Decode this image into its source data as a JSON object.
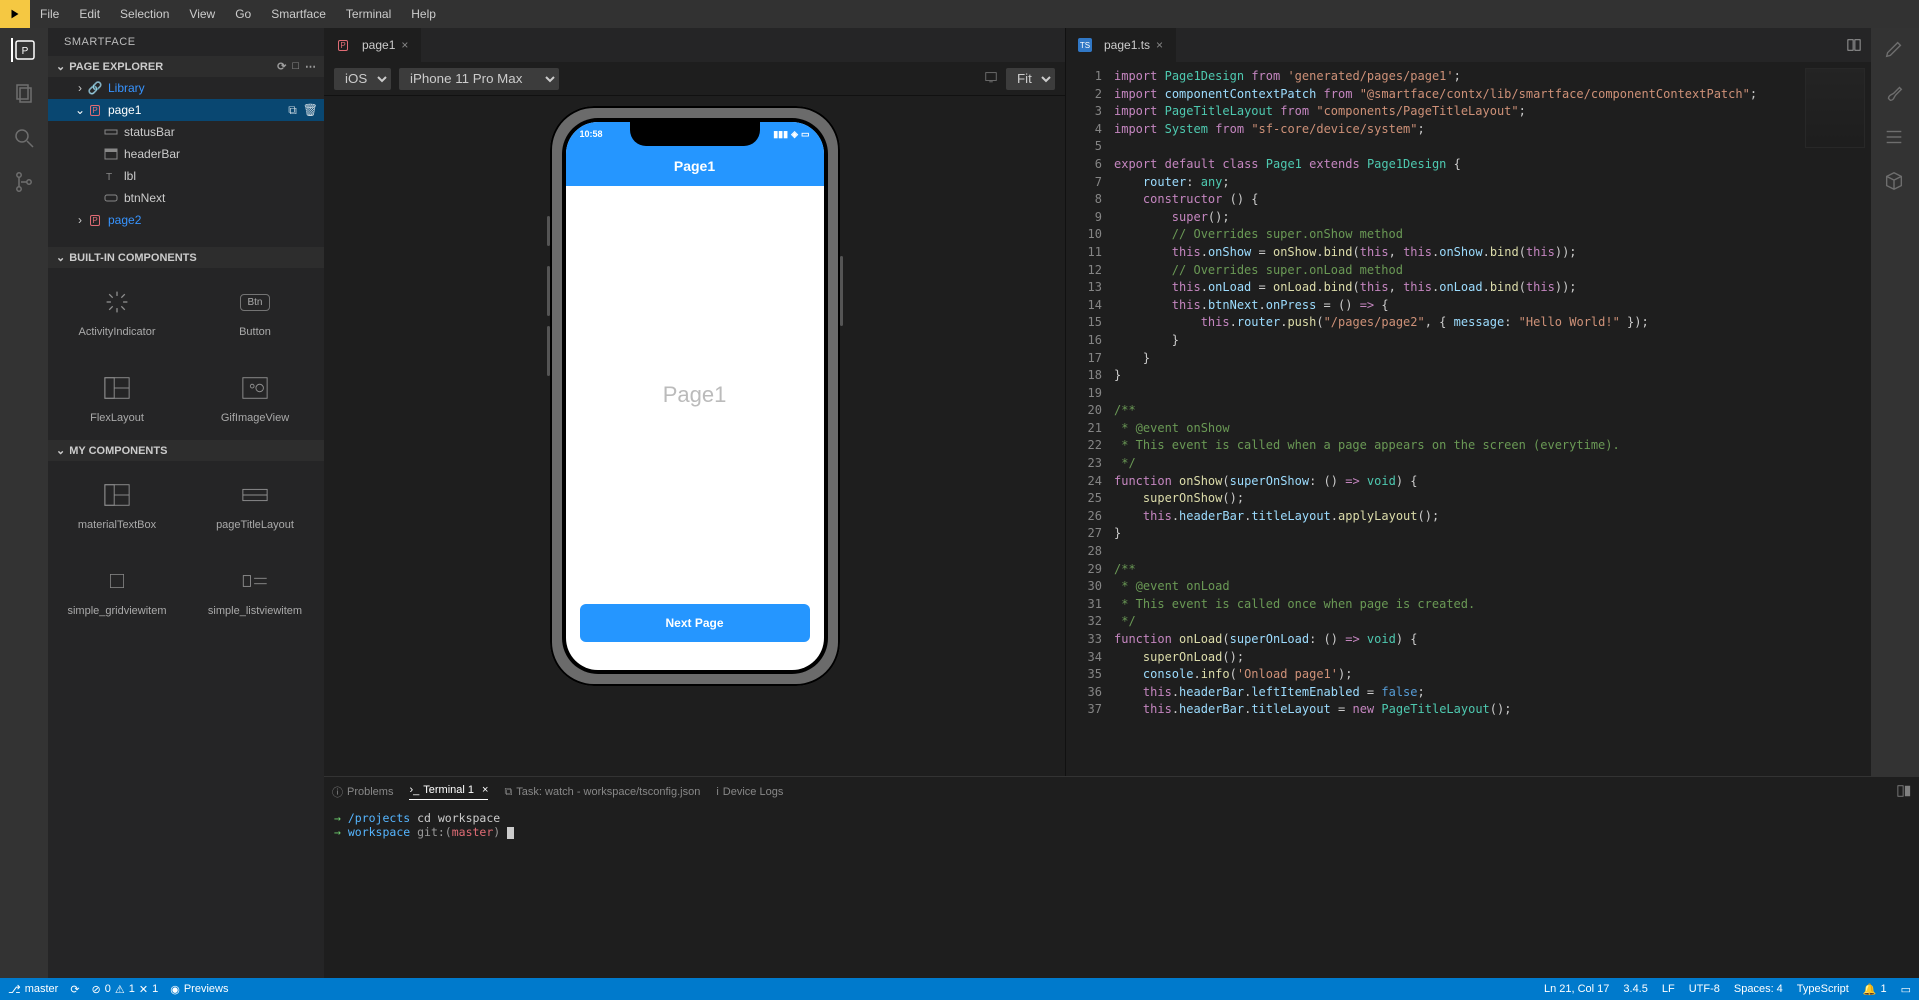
{
  "menubar": [
    "File",
    "Edit",
    "Selection",
    "View",
    "Go",
    "Smartface",
    "Terminal",
    "Help"
  ],
  "sidebar": {
    "title": "SMARTFACE",
    "sections": {
      "explorer": "PAGE EXPLORER",
      "builtin": "BUILT-IN COMPONENTS",
      "mycomp": "MY COMPONENTS"
    },
    "tree": {
      "library": "Library",
      "page1": "page1",
      "page1_children": [
        "statusBar",
        "headerBar",
        "lbl",
        "btnNext"
      ],
      "page2": "page2"
    },
    "builtin_items": [
      "ActivityIndicator",
      "Button",
      "FlexLayout",
      "GifImageView"
    ],
    "mycomp_items": [
      "materialTextBox",
      "pageTitleLayout",
      "simple_gridviewitem",
      "simple_listviewitem"
    ]
  },
  "designer": {
    "tab": "page1",
    "os": "iOS",
    "device": "iPhone 11 Pro Max",
    "zoom": "Fit",
    "phone": {
      "time": "10:58",
      "header_title": "Page1",
      "body_label": "Page1",
      "button": "Next Page"
    }
  },
  "editor": {
    "tab": "page1.ts",
    "lines": [
      {
        "n": 1,
        "html": "<span class='tok-kw'>import</span> <span class='tok-type'>Page1Design</span> <span class='tok-kw'>from</span> <span class='tok-str'>'generated/pages/page1'</span>;"
      },
      {
        "n": 2,
        "html": "<span class='tok-kw'>import</span> <span class='tok-var'>componentContextPatch</span> <span class='tok-kw'>from</span> <span class='tok-str'>\"@smartface/contx/lib/smartface/componentContextPatch\"</span>;"
      },
      {
        "n": 3,
        "html": "<span class='tok-kw'>import</span> <span class='tok-type'>PageTitleLayout</span> <span class='tok-kw'>from</span> <span class='tok-str'>\"components/PageTitleLayout\"</span>;"
      },
      {
        "n": 4,
        "html": "<span class='tok-kw'>import</span> <span class='tok-type'>System</span> <span class='tok-kw'>from</span> <span class='tok-str'>\"sf-core/device/system\"</span>;"
      },
      {
        "n": 5,
        "html": ""
      },
      {
        "n": 6,
        "html": "<span class='tok-kw'>export</span> <span class='tok-kw'>default</span> <span class='tok-kw'>class</span> <span class='tok-type'>Page1</span> <span class='tok-kw'>extends</span> <span class='tok-type'>Page1Design</span> {"
      },
      {
        "n": 7,
        "html": "    <span class='tok-var'>router</span>: <span class='tok-type'>any</span>;"
      },
      {
        "n": 8,
        "html": "    <span class='tok-kw'>constructor</span> () {"
      },
      {
        "n": 9,
        "html": "        <span class='tok-kw'>super</span>();"
      },
      {
        "n": 10,
        "html": "        <span class='tok-comm'>// Overrides super.onShow method</span>"
      },
      {
        "n": 11,
        "html": "        <span class='tok-kw'>this</span>.<span class='tok-var'>onShow</span> = <span class='tok-fn'>onShow</span>.<span class='tok-fn'>bind</span>(<span class='tok-kw'>this</span>, <span class='tok-kw'>this</span>.<span class='tok-var'>onShow</span>.<span class='tok-fn'>bind</span>(<span class='tok-kw'>this</span>));"
      },
      {
        "n": 12,
        "html": "        <span class='tok-comm'>// Overrides super.onLoad method</span>"
      },
      {
        "n": 13,
        "html": "        <span class='tok-kw'>this</span>.<span class='tok-var'>onLoad</span> = <span class='tok-fn'>onLoad</span>.<span class='tok-fn'>bind</span>(<span class='tok-kw'>this</span>, <span class='tok-kw'>this</span>.<span class='tok-var'>onLoad</span>.<span class='tok-fn'>bind</span>(<span class='tok-kw'>this</span>));"
      },
      {
        "n": 14,
        "html": "        <span class='tok-kw'>this</span>.<span class='tok-var'>btnNext</span>.<span class='tok-var'>onPress</span> = () <span class='tok-kw'>=&gt;</span> {"
      },
      {
        "n": 15,
        "html": "            <span class='tok-kw'>this</span>.<span class='tok-var'>router</span>.<span class='tok-fn'>push</span>(<span class='tok-str'>\"/pages/page2\"</span>, { <span class='tok-var'>message</span>: <span class='tok-str'>\"Hello World!\"</span> });"
      },
      {
        "n": 16,
        "html": "        }"
      },
      {
        "n": 17,
        "html": "    }"
      },
      {
        "n": 18,
        "html": "}"
      },
      {
        "n": 19,
        "html": ""
      },
      {
        "n": 20,
        "html": "<span class='tok-comm'>/**</span>"
      },
      {
        "n": 21,
        "html": "<span class='tok-comm'> * @event onShow</span>"
      },
      {
        "n": 22,
        "html": "<span class='tok-comm'> * This event is called when a page appears on the screen (everytime).</span>"
      },
      {
        "n": 23,
        "html": "<span class='tok-comm'> */</span>"
      },
      {
        "n": 24,
        "html": "<span class='tok-kw'>function</span> <span class='tok-fn'>onShow</span>(<span class='tok-var'>superOnShow</span>: () <span class='tok-kw'>=&gt;</span> <span class='tok-type'>void</span>) {"
      },
      {
        "n": 25,
        "html": "    <span class='tok-fn'>superOnShow</span>();"
      },
      {
        "n": 26,
        "html": "    <span class='tok-kw'>this</span>.<span class='tok-var'>headerBar</span>.<span class='tok-var'>titleLayout</span>.<span class='tok-fn'>applyLayout</span>();"
      },
      {
        "n": 27,
        "html": "}"
      },
      {
        "n": 28,
        "html": ""
      },
      {
        "n": 29,
        "html": "<span class='tok-comm'>/**</span>"
      },
      {
        "n": 30,
        "html": "<span class='tok-comm'> * @event onLoad</span>"
      },
      {
        "n": 31,
        "html": "<span class='tok-comm'> * This event is called once when page is created.</span>"
      },
      {
        "n": 32,
        "html": "<span class='tok-comm'> */</span>"
      },
      {
        "n": 33,
        "html": "<span class='tok-kw'>function</span> <span class='tok-fn'>onLoad</span>(<span class='tok-var'>superOnLoad</span>: () <span class='tok-kw'>=&gt;</span> <span class='tok-type'>void</span>) {"
      },
      {
        "n": 34,
        "html": "    <span class='tok-fn'>superOnLoad</span>();"
      },
      {
        "n": 35,
        "html": "    <span class='tok-var'>console</span>.<span class='tok-fn'>info</span>(<span class='tok-str'>'Onload page1'</span>);"
      },
      {
        "n": 36,
        "html": "    <span class='tok-kw'>this</span>.<span class='tok-var'>headerBar</span>.<span class='tok-var'>leftItemEnabled</span> = <span class='tok-bool'>false</span>;"
      },
      {
        "n": 37,
        "html": "    <span class='tok-kw'>this</span>.<span class='tok-var'>headerBar</span>.<span class='tok-var'>titleLayout</span> = <span class='tok-kw'>new</span> <span class='tok-type'>PageTitleLayout</span>();"
      }
    ]
  },
  "panel": {
    "tabs": {
      "problems": "Problems",
      "terminal": "Terminal 1",
      "task": "Task: watch - workspace/tsconfig.json",
      "device": "Device Logs"
    },
    "term": {
      "line1_cwd": "/projects",
      "line1_cmd": "cd workspace",
      "line2_cwd": "workspace",
      "line2_git": "git:(",
      "line2_branch": "master",
      "line2_git_close": ")"
    }
  },
  "statusbar": {
    "branch": "master",
    "errors": "0",
    "warnings": "1",
    "x": "1",
    "previews": "Previews",
    "right": {
      "pos": "Ln 21, Col 17",
      "ver": "3.4.5",
      "eol": "LF",
      "enc": "UTF-8",
      "spaces": "Spaces: 4",
      "lang": "TypeScript",
      "bell": "1"
    }
  }
}
